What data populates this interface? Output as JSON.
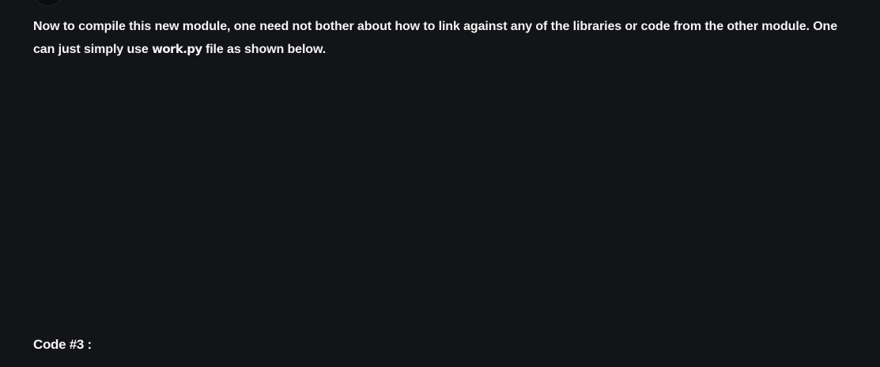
{
  "article": {
    "paragraph": {
      "text_before": "Now to compile this new module, one need not bother about how to link against any of the libraries or code from the other module. One can just simply use ",
      "inline_code": "work.py",
      "text_after": " file as shown below."
    },
    "code_heading": "Code #3 :"
  },
  "colors": {
    "background": "#131417",
    "text": "#f5f5f5"
  }
}
